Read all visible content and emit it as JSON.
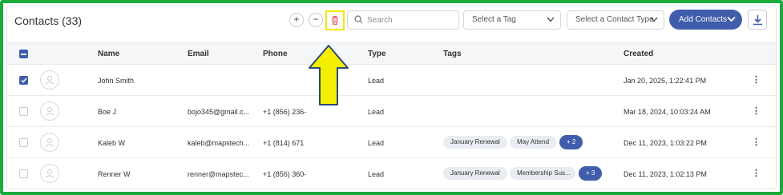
{
  "header": {
    "title": "Contacts (33)",
    "add_icon": "+",
    "remove_icon": "−",
    "search_placeholder": "Search",
    "tag_select": "Select a Tag",
    "type_select": "Select a Contact Type",
    "add_button": "Add Contacts"
  },
  "columns": [
    "Name",
    "Email",
    "Phone",
    "Type",
    "Tags",
    "Created"
  ],
  "rows": [
    {
      "checked": true,
      "name": "John Smith",
      "email": "",
      "phone": "",
      "type": "Lead",
      "tags": [],
      "more": "",
      "created": "Jan 20, 2025, 1:22:41 PM"
    },
    {
      "checked": false,
      "name": "Boe J\u0000",
      "email": "bojo345@gmail.c...",
      "phone": "+1 (856) 236-",
      "type": "Lead",
      "tags": [],
      "more": "",
      "created": "Mar 18, 2024, 10:03:24 AM"
    },
    {
      "checked": false,
      "name": "Kaleb W",
      "email": "kaleb@mapstech...",
      "phone": "+1 (814) 671",
      "type": "Lead",
      "tags": [
        "January Renewal",
        "May Attend"
      ],
      "more": "+ 2",
      "created": "Dec 11, 2023, 1:03:22 PM"
    },
    {
      "checked": false,
      "name": "Renner W",
      "email": "renner@mapstec...",
      "phone": "+1 (856) 360-",
      "type": "Lead",
      "tags": [
        "January Renewal",
        "Membership Sus..."
      ],
      "more": "+ 3",
      "created": "Dec 11, 2023, 1:02:13 PM"
    }
  ],
  "colors": {
    "accent": "#3f5daa",
    "frame": "#1aab3b",
    "highlight": "#f2e700",
    "danger": "#e0464f"
  },
  "icons": [
    "add-icon",
    "remove-icon",
    "trash-icon",
    "search-icon",
    "chevron-down-icon",
    "download-icon",
    "user-avatar-icon",
    "more-vertical-icon",
    "arrow-up-annotation"
  ]
}
